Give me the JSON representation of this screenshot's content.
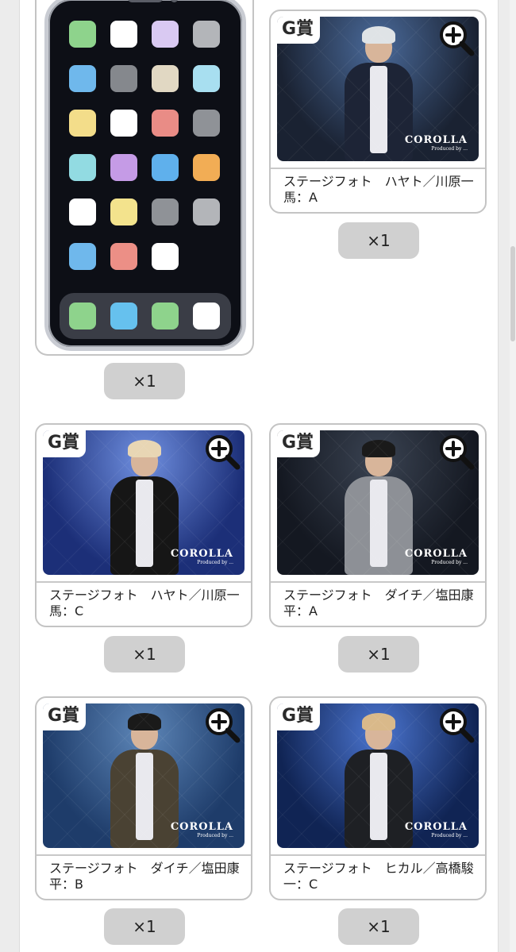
{
  "phone_wallpaper": {
    "quantity": "×1",
    "app_colors": [
      [
        "#8ed38c",
        "#ffffff",
        "#d9c9f2",
        "#b3b5b9"
      ],
      [
        "#6fb8ec",
        "#85888d",
        "#e1d8c3",
        "#a8dff0"
      ],
      [
        "#f3dd8a",
        "#ffffff",
        "#e98c86",
        "#8f9297"
      ],
      [
        "#92dbe2",
        "#c59be6",
        "#5fb0ec",
        "#f2ad55"
      ],
      [
        "#ffffff",
        "#f3e38d",
        "#8f9297",
        "#b3b5b9"
      ],
      [
        "#6fb8ec",
        "#ec8f86",
        "#ffffff",
        null
      ]
    ],
    "dock_colors": [
      "#8ed38c",
      "#66c1ee",
      "#8ed38c",
      "#ffffff"
    ]
  },
  "cards": [
    {
      "badge": "G賞",
      "caption": "ステージフォト　ハヤト／川原一馬：A",
      "quantity": "×1",
      "zoom_icon": "zoom-in-icon",
      "logo": "COROLLA",
      "logo_sub": "Produced by ...",
      "bg": "#1a2232",
      "spot": "#4a6a9a",
      "hair": "#dfe3e6",
      "jacket": "#1d2436"
    },
    {
      "badge": "G賞",
      "caption": "ステージフォト　ハヤト／川原一馬：C",
      "quantity": "×1",
      "zoom_icon": "zoom-in-icon",
      "logo": "COROLLA",
      "logo_sub": "Produced by ...",
      "bg": "#1c2f78",
      "spot": "#6f8fe0",
      "hair": "#e8d6b4",
      "jacket": "#161616"
    },
    {
      "badge": "G賞",
      "caption": "ステージフォト　ダイチ／塩田康平：A",
      "quantity": "×1",
      "zoom_icon": "zoom-in-icon",
      "logo": "COROLLA",
      "logo_sub": "Produced by ...",
      "bg": "#141821",
      "spot": "#3a4352",
      "hair": "#1a1a1a",
      "jacket": "#8d9096"
    },
    {
      "badge": "G賞",
      "caption": "ステージフォト　ダイチ／塩田康平：B",
      "quantity": "×1",
      "zoom_icon": "zoom-in-icon",
      "logo": "COROLLA",
      "logo_sub": "Produced by ...",
      "bg": "#1e3c6a",
      "spot": "#5d86b8",
      "hair": "#1a1a1a",
      "jacket": "#4a4233"
    },
    {
      "badge": "G賞",
      "caption": "ステージフォト　ヒカル／高橋駿一：C",
      "quantity": "×1",
      "zoom_icon": "zoom-in-icon",
      "logo": "COROLLA",
      "logo_sub": "Produced by ...",
      "bg": "#102454",
      "spot": "#4b75d0",
      "hair": "#d9b98a",
      "jacket": "#1e2024"
    }
  ]
}
